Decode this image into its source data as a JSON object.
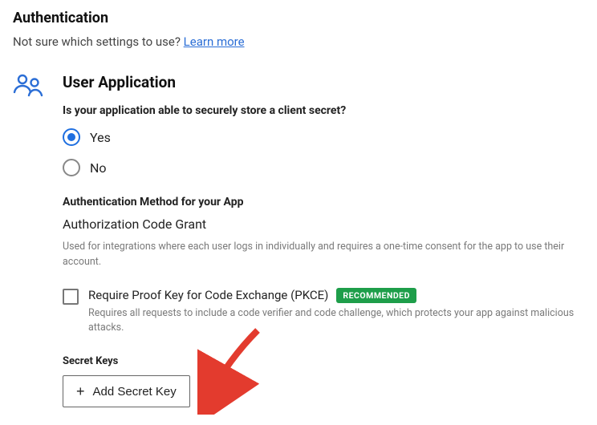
{
  "page": {
    "title": "Authentication",
    "hint_prefix": "Not sure which settings to use? ",
    "learn_more": "Learn more"
  },
  "section": {
    "title": "User Application",
    "secure_store_question": "Is your application able to securely store a client secret?",
    "radio_yes": "Yes",
    "radio_no": "No",
    "auth_method_heading": "Authentication Method for your App",
    "auth_method_name": "Authorization Code Grant",
    "auth_method_desc": "Used for integrations where each user logs in individually and requires a one-time consent for the app to use their account.",
    "pkce_label": "Require Proof Key for Code Exchange (PKCE)",
    "pkce_badge": "RECOMMENDED",
    "pkce_desc": "Requires all requests to include a code verifier and code challenge, which protects your app against malicious attacks.",
    "secret_keys_heading": "Secret Keys",
    "add_secret_key": "Add Secret Key"
  }
}
